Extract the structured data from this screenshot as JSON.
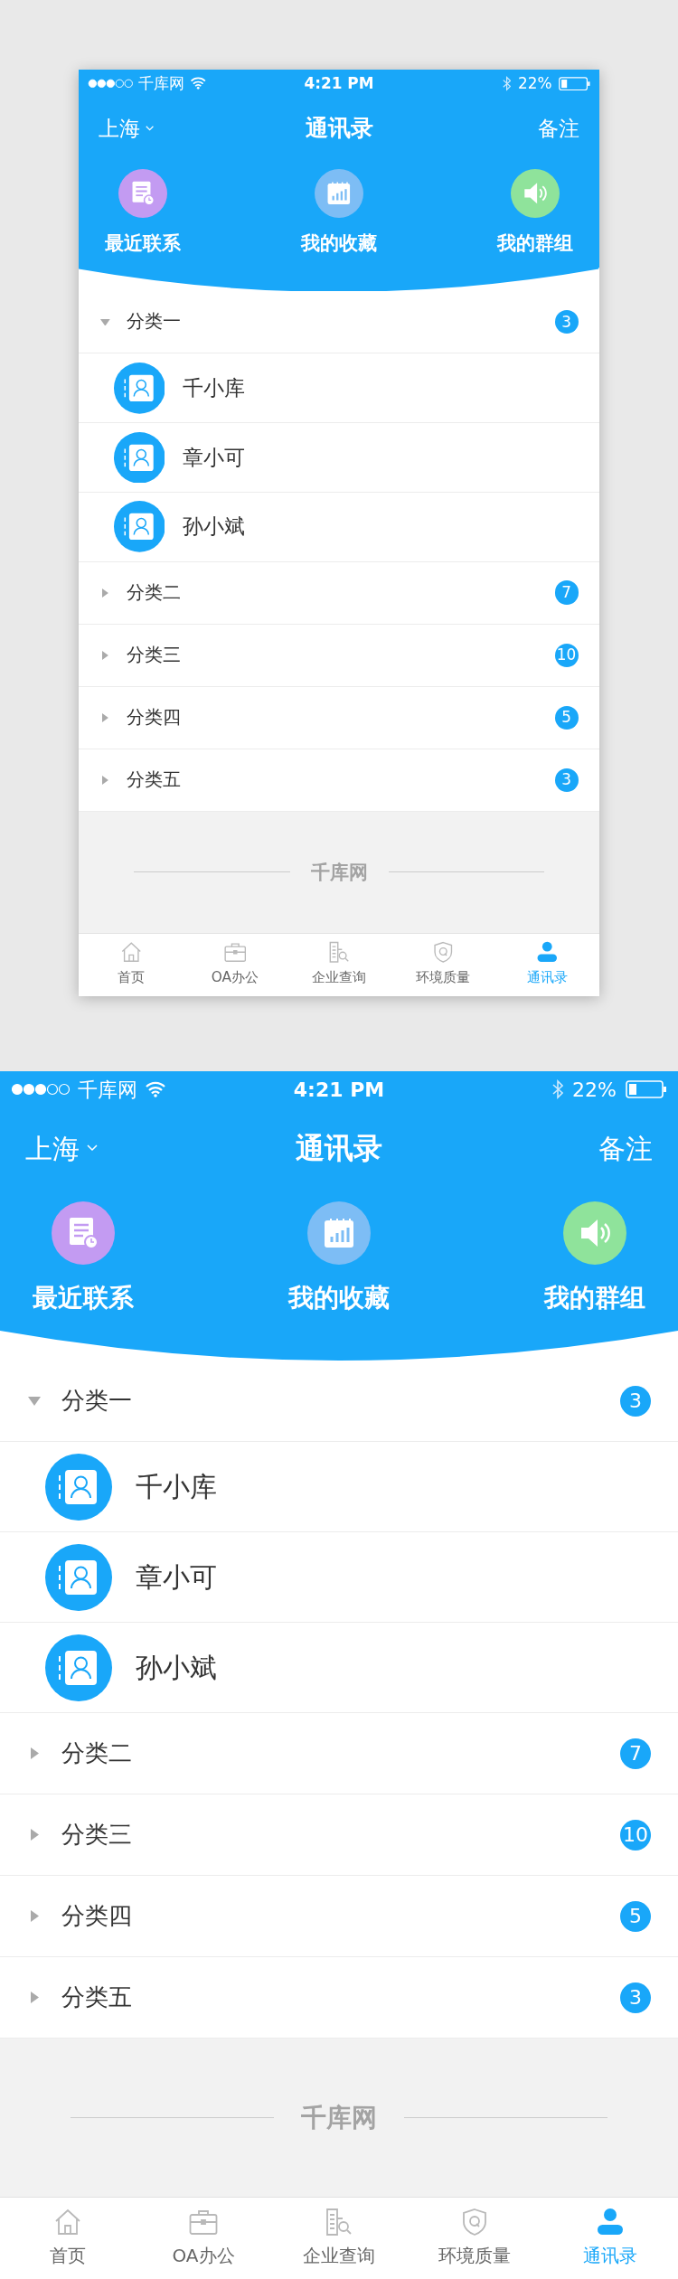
{
  "screens": [
    {
      "status_bar": {
        "carrier": "千库网",
        "time": "4:21 PM",
        "battery": "22%"
      },
      "nav": {
        "city": "上海",
        "title": "通讯录",
        "action": "备注"
      },
      "shortcuts": [
        {
          "label": "最近联系",
          "kind": "recent",
          "color": "#c39bf2"
        },
        {
          "label": "我的收藏",
          "kind": "favorites",
          "color": "#7dbdf5"
        },
        {
          "label": "我的群组",
          "kind": "groups",
          "color": "#8fe39b"
        }
      ],
      "groups": [
        {
          "name": "分类一",
          "count": "3",
          "expanded": true,
          "children": [
            {
              "name": "千小库"
            },
            {
              "name": "章小可"
            },
            {
              "name": "孙小斌"
            }
          ]
        },
        {
          "name": "分类二",
          "count": "7",
          "expanded": false
        },
        {
          "name": "分类三",
          "count": "10",
          "expanded": false
        },
        {
          "name": "分类四",
          "count": "5",
          "expanded": false
        },
        {
          "name": "分类五",
          "count": "3",
          "expanded": false
        }
      ],
      "footer_mark": "千库网",
      "tabs": [
        {
          "label": "首页",
          "kind": "home",
          "selected": false
        },
        {
          "label": "OA办公",
          "kind": "office",
          "selected": false
        },
        {
          "label": "企业查询",
          "kind": "company",
          "selected": false
        },
        {
          "label": "环境质量",
          "kind": "environment",
          "selected": false
        },
        {
          "label": "通讯录",
          "kind": "contacts",
          "selected": true
        }
      ]
    },
    {
      "status_bar": {
        "carrier": "千库网",
        "time": "4:21 PM",
        "battery": "22%"
      },
      "nav": {
        "city": "上海",
        "title": "通讯录",
        "action": "备注"
      },
      "shortcuts": [
        {
          "label": "最近联系",
          "kind": "recent",
          "color": "#c39bf2"
        },
        {
          "label": "我的收藏",
          "kind": "favorites",
          "color": "#7dbdf5"
        },
        {
          "label": "我的群组",
          "kind": "groups",
          "color": "#8fe39b"
        }
      ],
      "groups": [
        {
          "name": "分类一",
          "count": "3",
          "expanded": true,
          "children": [
            {
              "name": "千小库"
            },
            {
              "name": "章小可"
            },
            {
              "name": "孙小斌"
            }
          ]
        },
        {
          "name": "分类二",
          "count": "7",
          "expanded": false
        },
        {
          "name": "分类三",
          "count": "10",
          "expanded": false
        },
        {
          "name": "分类四",
          "count": "5",
          "expanded": false
        },
        {
          "name": "分类五",
          "count": "3",
          "expanded": false
        }
      ],
      "footer_mark": "千库网",
      "tabs": [
        {
          "label": "首页",
          "kind": "home",
          "selected": false
        },
        {
          "label": "OA办公",
          "kind": "office",
          "selected": false
        },
        {
          "label": "企业查询",
          "kind": "company",
          "selected": false
        },
        {
          "label": "环境质量",
          "kind": "environment",
          "selected": false
        },
        {
          "label": "通讯录",
          "kind": "contacts",
          "selected": true
        }
      ]
    }
  ]
}
